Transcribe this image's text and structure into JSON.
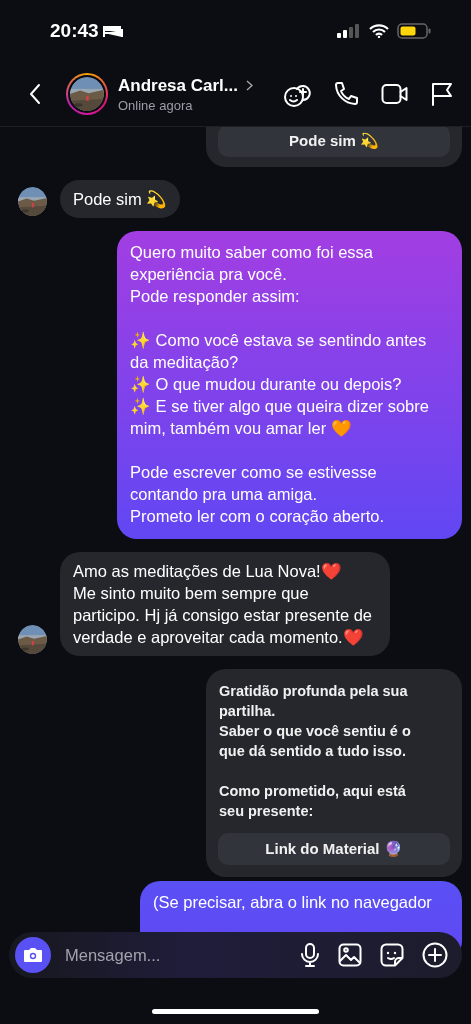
{
  "status_bar": {
    "time": "20:43"
  },
  "header": {
    "name": "Andresa Carl...",
    "subtitle": "Online agora"
  },
  "messages": [
    {
      "kind": "card",
      "button": "Pode sim 💫"
    },
    {
      "kind": "received",
      "text": "Pode sim 💫"
    },
    {
      "kind": "sent",
      "color": "#a23ee2",
      "text": "Quero muito saber como foi essa experiência pra você.\nPode responder assim:\n\n✨ Como você estava se sentindo antes da meditação?\n✨ O que mudou durante ou depois?\n✨ E se tiver algo que queira dizer sobre mim, também vou amar ler 🧡\n\nPode escrever como se estivesse contando pra uma amiga.\nPrometo ler com o coração aberto."
    },
    {
      "kind": "received",
      "text": "Amo as meditações de Lua Nova!❤️\nMe sinto muito bem sempre que participo. Hj já consigo estar presente de verdade e aproveitar cada momento.❤️"
    },
    {
      "kind": "card",
      "text": "Gratidão profunda pela sua partilha.\nSaber o que você sentiu é o que dá sentido a tudo isso.\n\nComo prometido, aqui está seu presente:",
      "button": "Link do Material 🔮"
    },
    {
      "kind": "sent",
      "color": "#5950f4",
      "text": "(Se precisar, abra o link no navegador"
    }
  ],
  "composer": {
    "placeholder": "Mensagem..."
  }
}
